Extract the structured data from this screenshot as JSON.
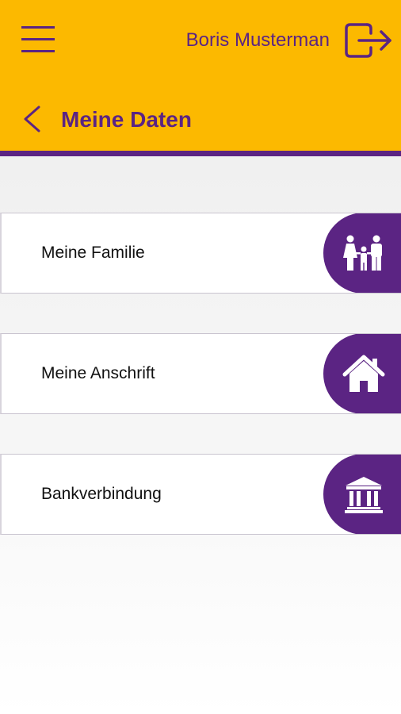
{
  "header": {
    "user_name": "Boris Musterman",
    "page_title": "Meine Daten",
    "menu_icon": "hamburger-menu-icon",
    "logout_icon": "logout-icon",
    "back_icon": "chevron-left-icon"
  },
  "theme": {
    "header_bg": "#fcb900",
    "accent": "#5b2483",
    "card_bg": "#ffffff",
    "page_bg": "#ececec"
  },
  "cards": [
    {
      "label": "Meine Familie",
      "icon": "family-icon"
    },
    {
      "label": "Meine Anschrift",
      "icon": "home-icon"
    },
    {
      "label": "Bankverbindung",
      "icon": "bank-icon"
    }
  ]
}
